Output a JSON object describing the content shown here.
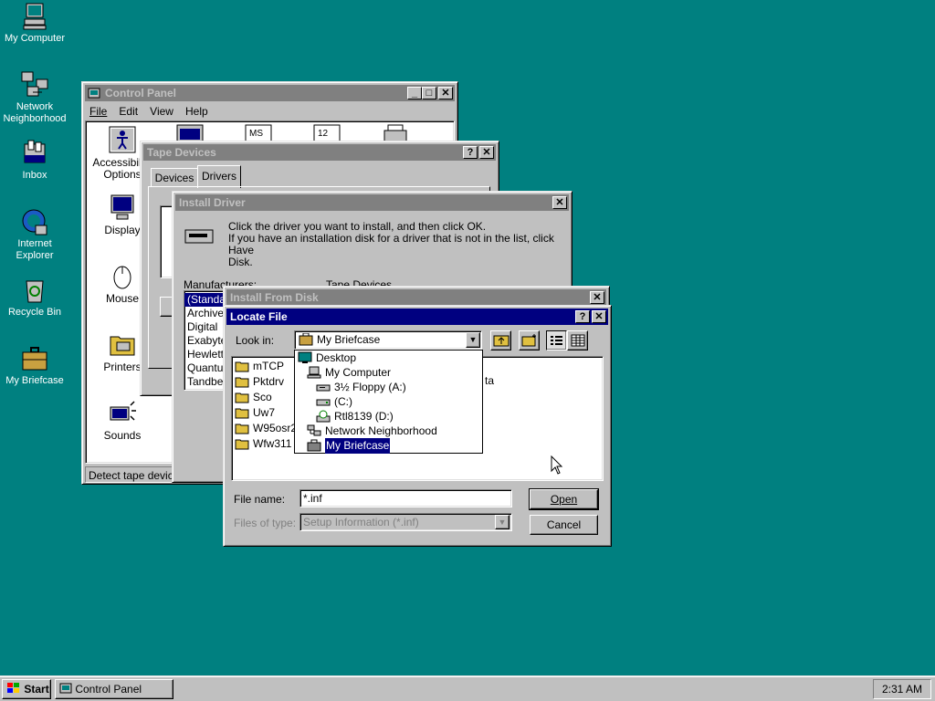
{
  "desktop": {
    "icons": [
      {
        "label_line1": "My Computer",
        "label_line2": ""
      },
      {
        "label_line1": "Network",
        "label_line2": "Neighborhood"
      },
      {
        "label_line1": "Inbox",
        "label_line2": ""
      },
      {
        "label_line1": "Internet",
        "label_line2": "Explorer"
      },
      {
        "label_line1": "Recycle Bin",
        "label_line2": ""
      },
      {
        "label_line1": "My Briefcase",
        "label_line2": ""
      }
    ],
    "background_color": "#008080"
  },
  "control_panel": {
    "title": "Control Panel",
    "menu": [
      "File",
      "Edit",
      "View",
      "Help"
    ],
    "icons": [
      {
        "label_line1": "Accessibility",
        "label_line2": "Options"
      },
      {
        "label_line1": "Display",
        "label_line2": ""
      },
      {
        "label_line1": "Mouse",
        "label_line2": ""
      },
      {
        "label_line1": "Printers",
        "label_line2": ""
      },
      {
        "label_line1": "Sounds",
        "label_line2": ""
      }
    ],
    "status": "Detect tape device"
  },
  "tape_devices": {
    "title": "Tape Devices",
    "tabs": [
      "Devices",
      "Drivers"
    ]
  },
  "install_driver": {
    "title": "Install Driver",
    "message_line1": "Click the driver you want to install, and then click OK.",
    "message_line2": "If you have an installation disk for a driver that is not in the list, click Have",
    "message_line3": "Disk.",
    "manufacturers_label": "Manufacturers:",
    "tape_devices_label": "Tape Devices",
    "manufacturers": [
      "(Standa",
      "Archive",
      "Digital",
      "Exabyte",
      "Hewlett",
      "Quantu",
      "Tandbe"
    ]
  },
  "install_from_disk": {
    "title": "Install From Disk"
  },
  "locate_file": {
    "title": "Locate File",
    "look_in_label": "Look in:",
    "look_in_value": "My Briefcase",
    "dropdown_items": [
      {
        "label": "Desktop",
        "icon": "desktop-icon",
        "indent": 0,
        "selected": false
      },
      {
        "label": "My Computer",
        "icon": "computer-icon",
        "indent": 1,
        "selected": false
      },
      {
        "label": "3½ Floppy (A:)",
        "icon": "floppy-icon",
        "indent": 2,
        "selected": false
      },
      {
        "label": "(C:)",
        "icon": "drive-icon",
        "indent": 2,
        "selected": false
      },
      {
        "label": "Rtl8139 (D:)",
        "icon": "cdrom-icon",
        "indent": 2,
        "selected": false
      },
      {
        "label": "Network Neighborhood",
        "icon": "network-icon",
        "indent": 1,
        "selected": false
      },
      {
        "label": "My Briefcase",
        "icon": "briefcase-icon",
        "indent": 1,
        "selected": true
      }
    ],
    "folders": [
      "mTCP",
      "Pktdrv",
      "Sco",
      "Uw7",
      "W95osr2",
      "Wfw311"
    ],
    "partial_right": [
      "ta"
    ],
    "file_name_label": "File name:",
    "file_name_value": "*.inf",
    "files_of_type_label": "Files of type:",
    "files_of_type_value": "Setup Information (*.inf)",
    "open_label": "Open",
    "cancel_label": "Cancel"
  },
  "taskbar": {
    "start_label": "Start",
    "task_label": "Control Panel",
    "clock": "2:31 AM"
  }
}
